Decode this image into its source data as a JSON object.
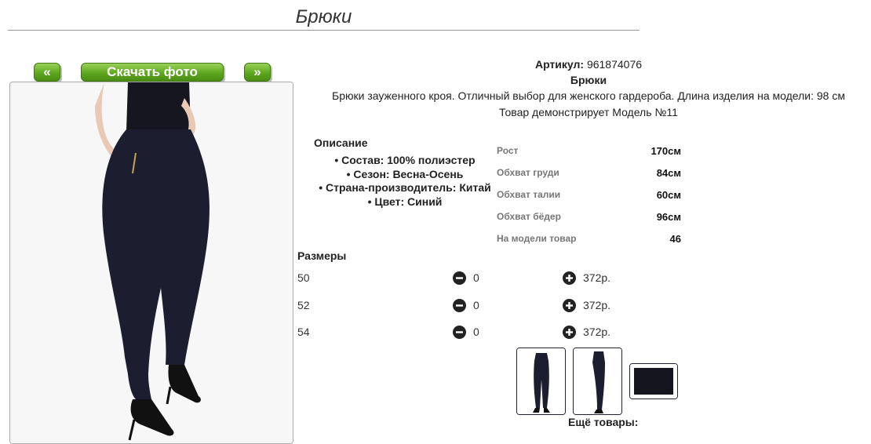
{
  "page": {
    "title": "Брюки"
  },
  "gallery": {
    "prev_label": "«",
    "download_label": "Скачать фото",
    "next_label": "»"
  },
  "product": {
    "article_label": "Артикул:",
    "article_value": "961874076",
    "name": "Брюки",
    "summary": "Брюки зауженного кроя. Отличный выбор для женского гардероба. Длина изделия на модели: 98 см",
    "model_note": "Товар демонстрирует Модель №11"
  },
  "description": {
    "title": "Описание",
    "items": [
      "• Состав: 100% полиэстер",
      "• Сезон: Весна-Осень",
      "• Страна-производитель: Китай",
      "• Цвет: Синий"
    ]
  },
  "measurements": [
    {
      "label": "Рост",
      "value": "170см"
    },
    {
      "label": "Обхват груди",
      "value": "84см"
    },
    {
      "label": "Обхват талии",
      "value": "60см"
    },
    {
      "label": "Обхват бёдер",
      "value": "96см"
    },
    {
      "label": "На модели товар",
      "value": "46"
    }
  ],
  "sizes": {
    "title": "Размеры",
    "rows": [
      {
        "size": "50",
        "qty": "0",
        "price": "372р."
      },
      {
        "size": "52",
        "qty": "0",
        "price": "372р."
      },
      {
        "size": "54",
        "qty": "0",
        "price": "372р."
      }
    ]
  },
  "more_products": "Ещё товары:",
  "colors": {
    "accent_green": "#5ea81f",
    "pants_navy": "#1c1d2e"
  },
  "icons": {
    "minus": "minus-circle-icon",
    "plus": "plus-circle-icon"
  }
}
